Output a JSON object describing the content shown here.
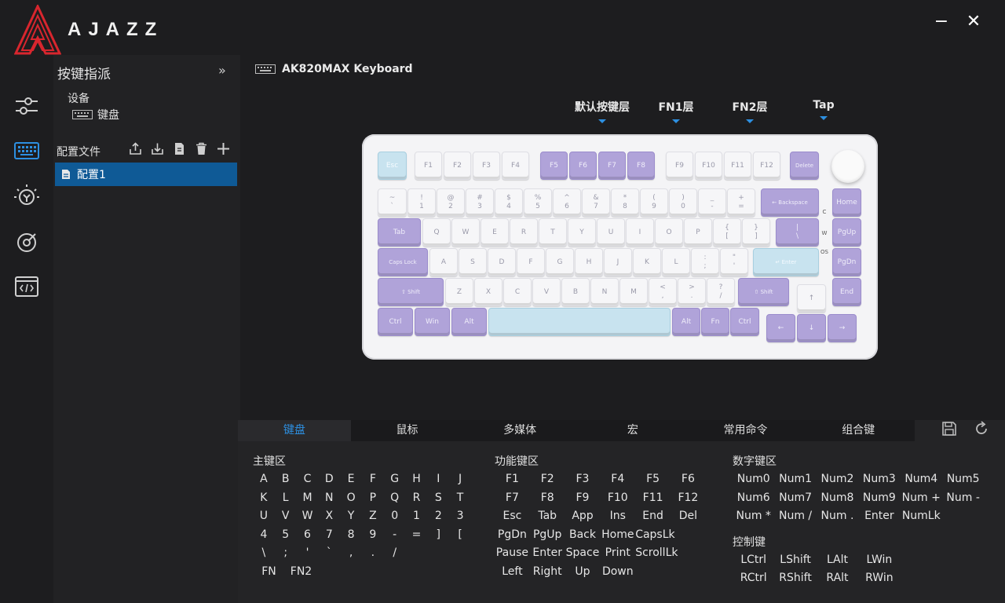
{
  "app": {
    "logo_text": "AJAZZ"
  },
  "window": {
    "minimize": "−",
    "close": "✕"
  },
  "icon_nav": [
    "sliders-icon",
    "keyboard-icon",
    "lightbulb-icon",
    "performance-icon",
    "code-icon"
  ],
  "panel": {
    "title": "按键指派",
    "collapse": "»",
    "device_label": "设备",
    "device_item": "键盘",
    "config_label": "配置文件",
    "config_item": "配置1"
  },
  "keyboard_title": "AK820MAX Keyboard",
  "layer_tabs": [
    {
      "label": "默认按键层",
      "active": true
    },
    {
      "label": "FN1层",
      "active": false
    },
    {
      "label": "FN2层",
      "active": false
    },
    {
      "label": "Tap",
      "active": false
    }
  ],
  "colors": {
    "accent": "#2d8fe0",
    "selected_bg": "#0f5a96",
    "keycap_purple": "#b0a3d9",
    "keycap_blue": "#c8e3ef",
    "keycap_white": "#f6f6f8"
  },
  "bottom_tabs": [
    {
      "label": "键盘",
      "active": true
    },
    {
      "label": "鼠标",
      "active": false
    },
    {
      "label": "多媒体",
      "active": false
    },
    {
      "label": "宏",
      "active": false
    },
    {
      "label": "常用命令",
      "active": false
    },
    {
      "label": "组合键",
      "active": false
    }
  ],
  "groups": {
    "main": {
      "title": "主键区",
      "keys": [
        "A",
        "B",
        "C",
        "D",
        "E",
        "F",
        "G",
        "H",
        "I",
        "J",
        "K",
        "L",
        "M",
        "N",
        "O",
        "P",
        "Q",
        "R",
        "S",
        "T",
        "U",
        "V",
        "W",
        "X",
        "Y",
        "Z",
        "0",
        "1",
        "2",
        "3",
        "4",
        "5",
        "6",
        "7",
        "8",
        "9",
        "-",
        "=",
        "]",
        "[",
        "\\",
        ";",
        "'",
        "`",
        ",",
        ".",
        "/"
      ],
      "extra": [
        "FN",
        "FN2"
      ]
    },
    "function": {
      "title": "功能键区",
      "keys": [
        "F1",
        "F2",
        "F3",
        "F4",
        "F5",
        "F6",
        "F7",
        "F8",
        "F9",
        "F10",
        "F11",
        "F12",
        "Esc",
        "Tab",
        "App",
        "Ins",
        "End",
        "Del",
        "PgDn",
        "PgUp",
        "Back",
        "Home",
        "CapsLk",
        "",
        "Pause",
        "Enter",
        "Space",
        "Print",
        "ScrollLk",
        "",
        "Left",
        "Right",
        "Up",
        "Down"
      ]
    },
    "numpad": {
      "title": "数字键区",
      "keys": [
        "Num0",
        "Num1",
        "Num2",
        "Num3",
        "Num4",
        "Num5",
        "Num6",
        "Num7",
        "Num8",
        "Num9",
        "Num +",
        "Num -",
        "Num *",
        "Num /",
        "Num .",
        "Enter",
        "NumLk"
      ]
    },
    "control": {
      "title": "控制键",
      "keys": [
        "LCtrl",
        "LShift",
        "LAlt",
        "LWin",
        "RCtrl",
        "RShift",
        "RAlt",
        "RWin"
      ]
    }
  },
  "side_labels": [
    "C",
    "W",
    "OS"
  ],
  "keys": [
    [
      "Esc",
      "b",
      20,
      22,
      37
    ],
    [
      "F1",
      "w",
      67,
      22,
      35
    ],
    [
      "F2",
      "w",
      104,
      22,
      35
    ],
    [
      "F3",
      "w",
      141,
      22,
      35
    ],
    [
      "F4",
      "w",
      178,
      22,
      35
    ],
    [
      "F5",
      "p",
      227,
      22,
      35
    ],
    [
      "F6",
      "p",
      264,
      22,
      35
    ],
    [
      "F7",
      "p",
      301,
      22,
      35
    ],
    [
      "F8",
      "p",
      338,
      22,
      35
    ],
    [
      "F9",
      "w",
      387,
      22,
      35
    ],
    [
      "F10",
      "w",
      424,
      22,
      35
    ],
    [
      "F11",
      "w",
      461,
      22,
      35
    ],
    [
      "F12",
      "w",
      498,
      22,
      35
    ],
    [
      "Delete",
      "p",
      545,
      22,
      37
    ],
    [
      "~\n`",
      "w",
      20,
      69,
      37
    ],
    [
      "!\n1",
      "w",
      58,
      69,
      36
    ],
    [
      "@\n2",
      "w",
      95,
      69,
      36
    ],
    [
      "#\n3",
      "w",
      132,
      69,
      36
    ],
    [
      "$\n4",
      "w",
      169,
      69,
      36
    ],
    [
      "%\n5",
      "w",
      206,
      69,
      36
    ],
    [
      "^\n6",
      "w",
      243,
      69,
      36
    ],
    [
      "&\n7",
      "w",
      280,
      69,
      36
    ],
    [
      "*\n8",
      "w",
      317,
      69,
      36
    ],
    [
      "(\n9",
      "w",
      354,
      69,
      36
    ],
    [
      ")\n0",
      "w",
      391,
      69,
      36
    ],
    [
      "_\n-",
      "w",
      428,
      69,
      36
    ],
    [
      "+\n=",
      "w",
      465,
      69,
      36
    ],
    [
      "← Backspace",
      "p",
      508,
      69,
      74
    ],
    [
      "Home",
      "p",
      599,
      69,
      37
    ],
    [
      "Tab",
      "p",
      20,
      107,
      55
    ],
    [
      "Q",
      "w",
      77,
      107,
      36
    ],
    [
      "W",
      "w",
      114,
      107,
      36
    ],
    [
      "E",
      "w",
      151,
      107,
      36
    ],
    [
      "R",
      "w",
      188,
      107,
      36
    ],
    [
      "T",
      "w",
      225,
      107,
      36
    ],
    [
      "Y",
      "w",
      262,
      107,
      36
    ],
    [
      "U",
      "w",
      299,
      107,
      36
    ],
    [
      "I",
      "w",
      336,
      107,
      36
    ],
    [
      "O",
      "w",
      373,
      107,
      36
    ],
    [
      "P",
      "w",
      410,
      107,
      36
    ],
    [
      "{\n[",
      "w",
      447,
      107,
      36
    ],
    [
      "}\n]",
      "w",
      484,
      107,
      36
    ],
    [
      "|\n\\",
      "p",
      527,
      107,
      55
    ],
    [
      "PgUp",
      "p",
      599,
      107,
      37
    ],
    [
      "Caps Lock",
      "p",
      20,
      145,
      64
    ],
    [
      "A",
      "w",
      86,
      145,
      36
    ],
    [
      "S",
      "w",
      123,
      145,
      36
    ],
    [
      "D",
      "w",
      160,
      145,
      36
    ],
    [
      "F",
      "w",
      197,
      145,
      36
    ],
    [
      "G",
      "w",
      234,
      145,
      36
    ],
    [
      "H",
      "w",
      271,
      145,
      36
    ],
    [
      "J",
      "w",
      308,
      145,
      36
    ],
    [
      "K",
      "w",
      345,
      145,
      36
    ],
    [
      "L",
      "w",
      382,
      145,
      36
    ],
    [
      ":\n;",
      "w",
      419,
      145,
      36
    ],
    [
      "\"\n'",
      "w",
      456,
      145,
      36
    ],
    [
      "↵ Enter",
      "b",
      498,
      145,
      84
    ],
    [
      "PgDn",
      "p",
      599,
      145,
      37
    ],
    [
      "⇧ Shift",
      "p",
      20,
      183,
      84
    ],
    [
      "Z",
      "w",
      106,
      183,
      36
    ],
    [
      "X",
      "w",
      143,
      183,
      36
    ],
    [
      "C",
      "w",
      180,
      183,
      36
    ],
    [
      "V",
      "w",
      217,
      183,
      36
    ],
    [
      "B",
      "w",
      254,
      183,
      36
    ],
    [
      "N",
      "w",
      291,
      183,
      36
    ],
    [
      "M",
      "w",
      328,
      183,
      36
    ],
    [
      "<\n,",
      "w",
      365,
      183,
      36
    ],
    [
      ">\n.",
      "w",
      402,
      183,
      36
    ],
    [
      "?\n/",
      "w",
      439,
      183,
      36
    ],
    [
      "⇧ Shift",
      "p",
      479,
      183,
      65
    ],
    [
      "↑",
      "w",
      554,
      191,
      37
    ],
    [
      "End",
      "p",
      599,
      183,
      37
    ],
    [
      "Ctrl",
      "p",
      20,
      221,
      45
    ],
    [
      "Win",
      "p",
      67,
      221,
      45
    ],
    [
      "Alt",
      "p",
      114,
      221,
      45
    ],
    [
      "",
      "b",
      161,
      221,
      232
    ],
    [
      "Alt",
      "p",
      395,
      221,
      36
    ],
    [
      "Fn",
      "p",
      432,
      221,
      36
    ],
    [
      "Ctrl",
      "p",
      469,
      221,
      37
    ],
    [
      "←",
      "p",
      515,
      229,
      37
    ],
    [
      "↓",
      "p",
      554,
      229,
      37
    ],
    [
      "→",
      "p",
      593,
      229,
      37
    ]
  ]
}
